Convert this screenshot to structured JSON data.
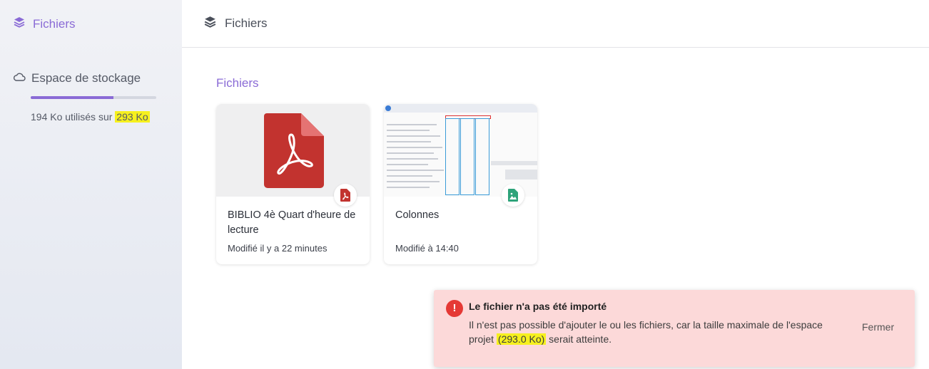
{
  "sidebar": {
    "nav_label": "Fichiers",
    "storage_title": "Espace de stockage",
    "storage_used_prefix": "194 Ko utilisés sur ",
    "storage_total": "293 Ko",
    "storage_fraction": 0.66
  },
  "topbar": {
    "title": "Fichiers"
  },
  "main": {
    "section_title": "Fichiers",
    "files": [
      {
        "name": "BIBLIO 4è Quart d'heure de lecture",
        "modified": "Modifié il y a 22 minutes",
        "type_icon": "pdf-icon"
      },
      {
        "name": "Colonnes",
        "modified": "Modifié à 14:40",
        "type_icon": "image-icon"
      }
    ]
  },
  "toast": {
    "title": "Le fichier n'a pas été importé",
    "body_prefix": "Il n'est pas possible d'ajouter le ou les fichiers, car la taille maximale de l'espace projet ",
    "body_highlight": "(293.0 Ko)",
    "body_suffix": " serait atteinte.",
    "close_label": "Fermer"
  },
  "colors": {
    "accent": "#8a6bd6",
    "error": "#e53935",
    "toast_bg": "#fcd9d9",
    "pdf_red": "#c2332f",
    "image_green": "#2ea37a",
    "highlight": "#f6f01e"
  }
}
